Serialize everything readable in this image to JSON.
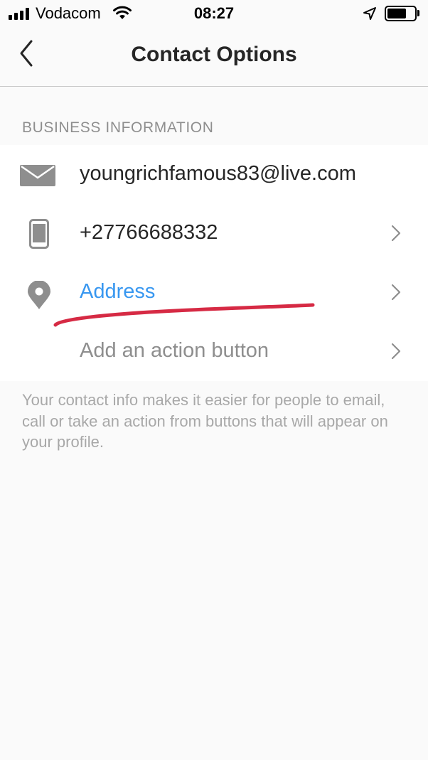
{
  "status_bar": {
    "carrier": "Vodacom",
    "time": "08:27",
    "signal_bars": 4,
    "battery_level": 0.7
  },
  "nav": {
    "title": "Contact Options",
    "back_icon": "chevron-left-icon"
  },
  "section": {
    "header": "BUSINESS INFORMATION"
  },
  "rows": [
    {
      "icon": "envelope-icon",
      "label": "youngrichfamous83@live.com",
      "has_chevron": false,
      "color": "#262626"
    },
    {
      "icon": "mobile-phone-icon",
      "label": "+27766688332",
      "has_chevron": true,
      "color": "#262626"
    },
    {
      "icon": "location-pin-icon",
      "label": "Address",
      "has_chevron": true,
      "color": "#3897f0"
    },
    {
      "icon": "",
      "label": "Add an action button",
      "has_chevron": true,
      "color": "#8e8e8e"
    }
  ],
  "footer": {
    "note": "Your contact info makes it easier for people to email, call or take an action from buttons that will appear on your profile."
  },
  "colors": {
    "accent": "#3897f0",
    "annotation_red": "#d62a44",
    "icon_gray": "#8e8e8e"
  }
}
